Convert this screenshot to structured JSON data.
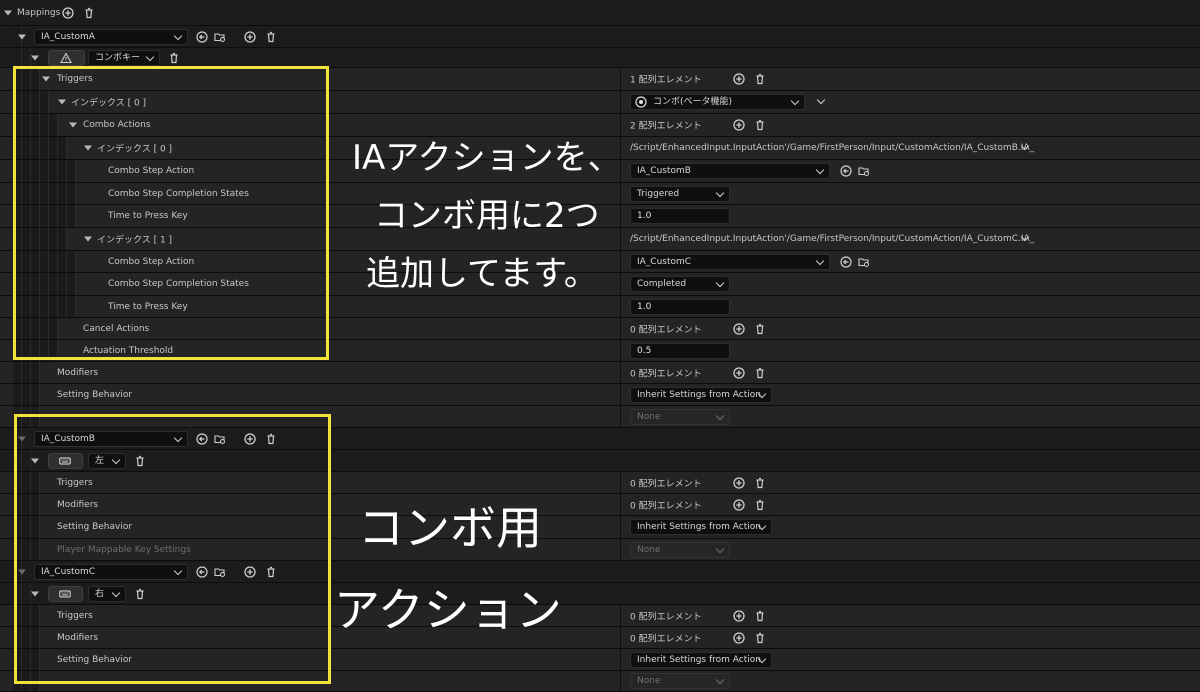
{
  "tree": {
    "mappings_label": "Mappings",
    "mapping_a": {
      "action": "IA_CustomA",
      "key": "コンボキー"
    },
    "triggers_label": "Triggers",
    "triggers_value": "1 配列エレメント",
    "index0_label": "インデックス [ 0 ]",
    "combo_dropdown": "コンボ(ベータ機能)",
    "combo_actions_label": "Combo Actions",
    "combo_actions_value": "2 配列エレメント",
    "combo_index0_label": "インデックス [ 0 ]",
    "combo_index0_path": "/Script/EnhancedInput.InputAction'/Game/FirstPerson/Input/CustomAction/IA_CustomB.IA_",
    "combo_step_action_label": "Combo Step Action",
    "step0_action": "IA_CustomB",
    "combo_step_states_label": "Combo Step Completion States",
    "step0_state": "Triggered",
    "time_to_press_label": "Time to Press Key",
    "step0_time": "1.0",
    "combo_index1_label": "インデックス [ 1 ]",
    "combo_index1_path": "/Script/EnhancedInput.InputAction'/Game/FirstPerson/Input/CustomAction/IA_CustomC.IA_",
    "step1_action": "IA_CustomC",
    "step1_state": "Completed",
    "step1_time": "1.0",
    "cancel_actions_label": "Cancel Actions",
    "cancel_actions_value": "0 配列エレメント",
    "actuation_label": "Actuation Threshold",
    "actuation_value": "0.5",
    "modifiers_label": "Modifiers",
    "modifiers_value": "0 配列エレメント",
    "setting_behavior_label": "Setting Behavior",
    "setting_behavior_value": "Inherit Settings from Action",
    "pmks_label": "Player Mappable Key Settings",
    "none_value": "None",
    "mapping_b": {
      "action": "IA_CustomB",
      "key": "左"
    },
    "mapping_c": {
      "action": "IA_CustomC",
      "key": "右"
    }
  },
  "annotations": {
    "note1_line1": "IAアクションを、",
    "note1_line2": "コンボ用に2つ",
    "note1_line3": "追加してます。",
    "note2_line1": "コンボ用",
    "note2_line2": "アクション"
  },
  "colors": {
    "highlight": "#f2e23a",
    "panel": "#242424",
    "background": "#161616"
  }
}
